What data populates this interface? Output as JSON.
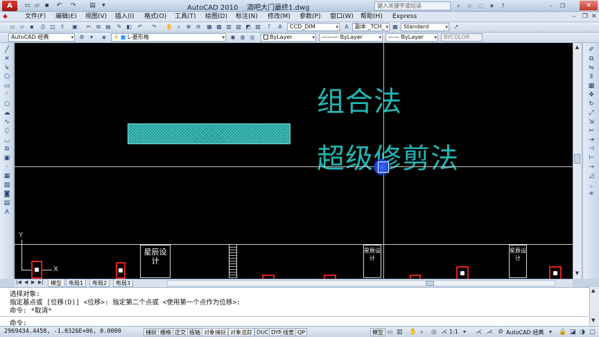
{
  "title_bar": {
    "app_name": "AutoCAD 2010",
    "filename": "酒吧大门最终1.dwg",
    "search_placeholder": "键入关键字或短语"
  },
  "menus": [
    "文件(F)",
    "编辑(E)",
    "视图(V)",
    "插入(I)",
    "格式(O)",
    "工具(T)",
    "绘图(D)",
    "标注(N)",
    "修改(M)",
    "参数(P)",
    "窗口(W)",
    "帮助(H)",
    "Express"
  ],
  "toolbar": {
    "workspace": "AutoCAD 经典",
    "layer": "L-菱形格",
    "dim_style": "CCD_DIM",
    "text_style": "副本 _TCH_",
    "table_style": "Standard",
    "color": "ByLayer",
    "linetype": "ByLayer",
    "lineweight": "ByLayer",
    "plot_style": "BYCOLOR"
  },
  "drawing": {
    "text_line1": "组合法",
    "text_line2": "超级修剪法",
    "title_block_text": "星辰设计",
    "ucs_x": "X",
    "ucs_y": "Y"
  },
  "layout_tabs": [
    "模型",
    "布局1",
    "布局2",
    "布局3"
  ],
  "command": {
    "lines": [
      "选择对象:",
      "指定基点或 [位移(D)] <位移>:  指定第二个点或 <使用第一个点作为位移>:",
      "命令: *取消*"
    ],
    "prompt": "命令:"
  },
  "status": {
    "coords": "2969434.4458, -1.0326E+06, 0.0000",
    "toggles": [
      "捕捉",
      "栅格",
      "正交",
      "极轴",
      "对象捕捉",
      "对象追踪",
      "DUCS",
      "DYN",
      "线宽",
      "QP"
    ],
    "model_label": "模型",
    "scale": "1:1",
    "workspace": "AutoCAD 经典"
  },
  "colors": {
    "canvas_bg": "#000000",
    "cyan_text": "#23b6b4",
    "hatch": "#1b8c8a",
    "marker_red": "#e12020"
  }
}
